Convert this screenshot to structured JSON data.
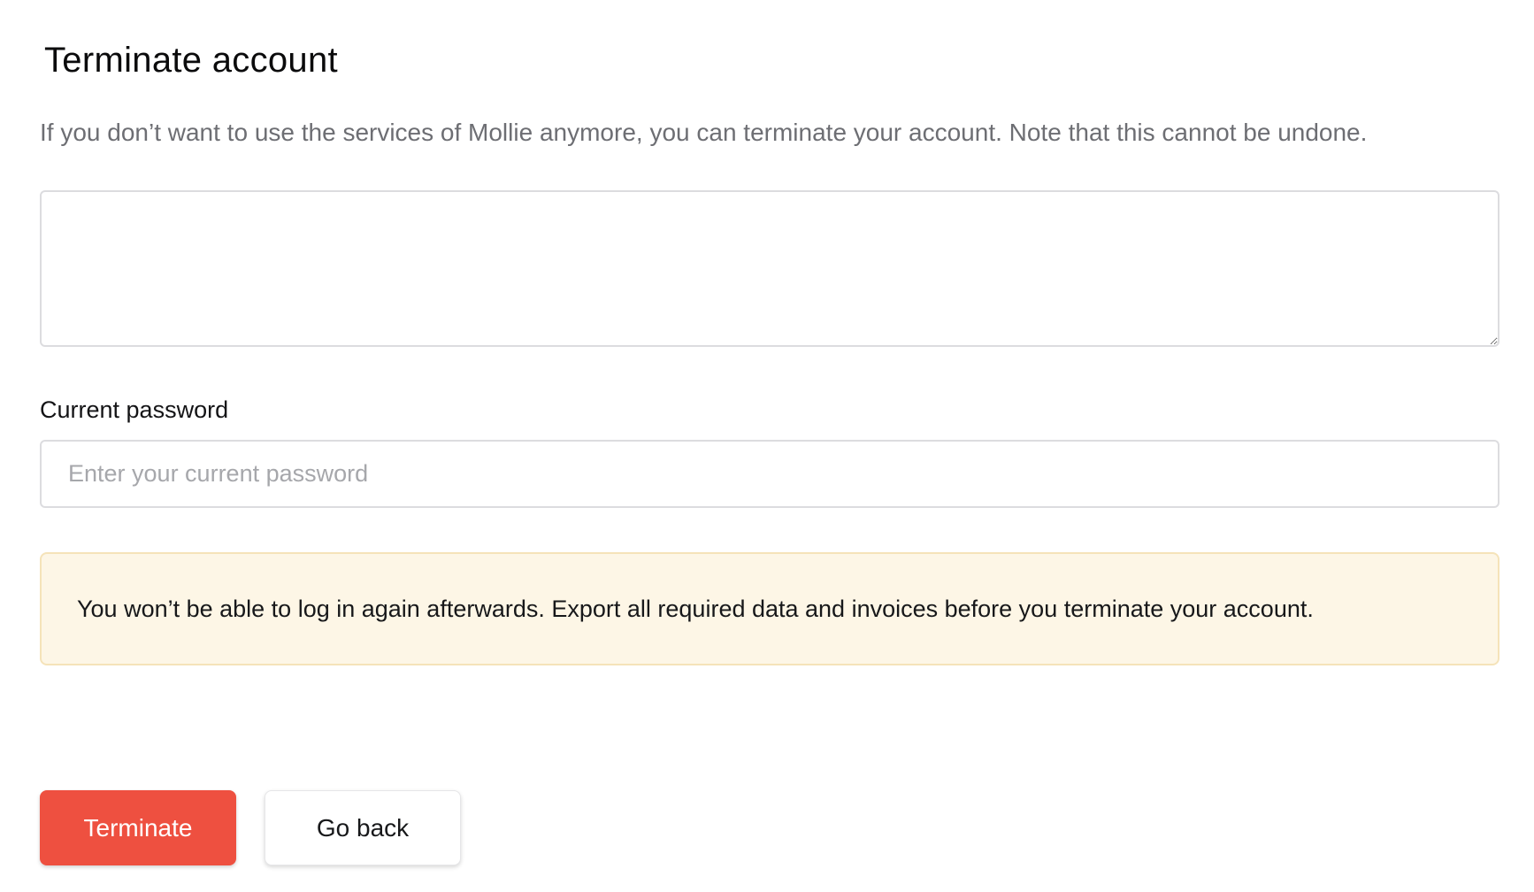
{
  "page": {
    "title": "Terminate account",
    "description": "If you don’t want to use the services of Mollie anymore, you can terminate your account. Note that this cannot be undone."
  },
  "form": {
    "reason": {
      "value": "",
      "placeholder": ""
    },
    "password": {
      "label": "Current password",
      "value": "",
      "placeholder": "Enter your current password"
    }
  },
  "warning": {
    "text": "You won’t be able to log in again afterwards. Export all required data and invoices before you terminate your account.",
    "background_color": "#fdf6e6",
    "border_color": "#f5e3b9"
  },
  "actions": {
    "terminate_label": "Terminate",
    "back_label": "Go back",
    "terminate_color": "#ee5040"
  }
}
